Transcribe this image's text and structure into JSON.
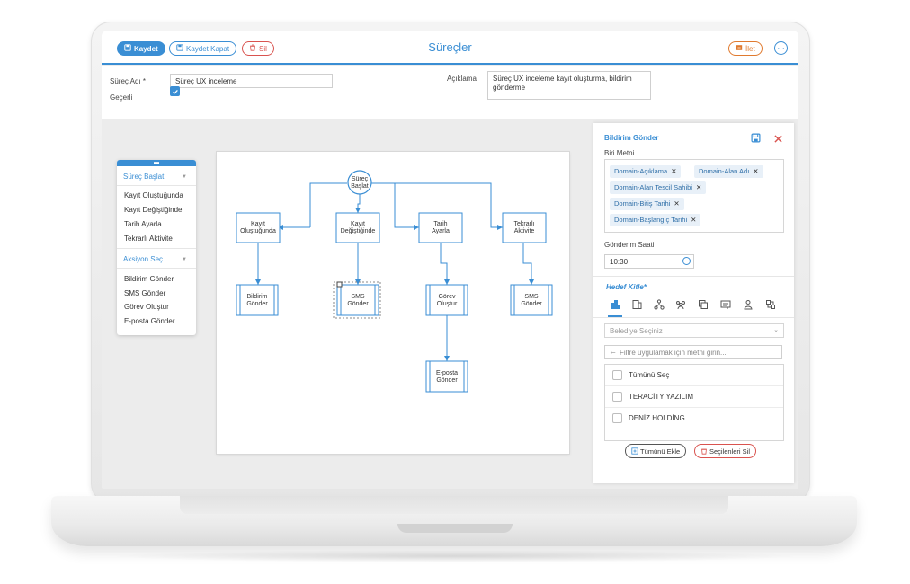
{
  "toolbar": {
    "save_label": "Kaydet",
    "save_close_label": "Kaydet Kapat",
    "delete_label": "Sil",
    "forward_label": "İlet",
    "more_label": "···"
  },
  "page": {
    "title": "Süreçler"
  },
  "form": {
    "process_name_label": "Süreç Adı *",
    "process_name_value": "Süreç UX inceleme",
    "valid_label": "Geçerli",
    "valid_checked": true,
    "description_label": "Açıklama",
    "description_value": "Süreç UX inceleme kayıt oluşturma, bildirim gönderme"
  },
  "palette": {
    "start_section": "Süreç Başlat",
    "start_items": [
      "Kayıt Oluştuğunda",
      "Kayıt Değiştiğinde",
      "Tarih Ayarla",
      "Tekrarlı Aktivite"
    ],
    "action_section": "Aksiyon Seç",
    "action_items": [
      "Bildirim Gönder",
      "SMS Gönder",
      "Görev Oluştur",
      "E-posta Gönder"
    ]
  },
  "flow": {
    "start_node": [
      "Süreç",
      "Başlat"
    ],
    "triggers": [
      [
        "Kayıt",
        "Oluştuğunda"
      ],
      [
        "Kayıt",
        "Değiştiğinde"
      ],
      [
        "Tarih",
        "Ayarla"
      ],
      [
        "Tekrarlı",
        "Aktivite"
      ]
    ],
    "actions": [
      [
        "Bildirim",
        "Gönder"
      ],
      [
        "SMS",
        "Gönder"
      ],
      [
        "Görev",
        "Oluştur"
      ],
      [
        "SMS",
        "Gönder"
      ]
    ],
    "sub_action": [
      "E-posta",
      "Gönder"
    ]
  },
  "panel": {
    "title": "Bildirim Gönder",
    "message_label": "Biri Metni",
    "tags": [
      "Domain-Açıklama",
      "Domain-Alan Adı",
      "Domain-Alan Tescil Sahibi",
      "Domain-Bitiş Tarihi",
      "Domain-Başlangıç Tarihi"
    ],
    "send_time_label": "Gönderim Saati",
    "send_time_value": "10:30",
    "audience_label": "Hedef Kitle*",
    "municipality_placeholder": "Belediye Seçiniz",
    "filter_placeholder": "Filtre uygulamak için metni girin...",
    "list": [
      "Tümünü Seç",
      "TERACİTY YAZILIM",
      "DENİZ HOLDİNG"
    ],
    "add_all_label": "Tümünü Ekle",
    "delete_selected_label": "Seçilenleri Sil"
  },
  "colors": {
    "accent": "#3a8ed4",
    "danger": "#d9534f",
    "orange": "#e07a2f"
  },
  "icons": {
    "audience_tabs": [
      "building-icon",
      "office-icon",
      "hierarchy-icon",
      "group-icon",
      "copy-icon",
      "id-card-icon",
      "user-icon",
      "sync-icon"
    ]
  }
}
